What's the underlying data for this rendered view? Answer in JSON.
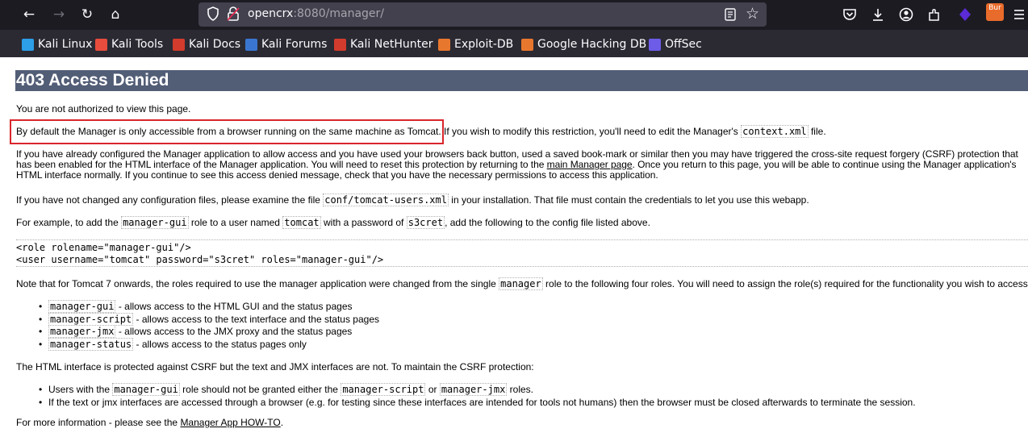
{
  "browser": {
    "nav": {
      "back": "←",
      "forward": "→",
      "reload": "↻",
      "home": "⌂"
    },
    "url": {
      "host": "opencrx",
      "rest": ":8080/manager/"
    },
    "toolbar_icons": [
      "pocket-icon",
      "download-icon",
      "account-icon",
      "extensions-icon",
      "kali-extension-icon",
      "burp-icon",
      "menu-icon"
    ],
    "burp_label": "Bur",
    "bookmarks": [
      {
        "label": "Kali Linux",
        "color": "#2d9ee8"
      },
      {
        "label": "Kali Tools",
        "color": "#e84c3d"
      },
      {
        "label": "Kali Docs",
        "color": "#d33b2c"
      },
      {
        "label": "Kali Forums",
        "color": "#3a76d1"
      },
      {
        "label": "Kali NetHunter",
        "color": "#d33b2c"
      },
      {
        "label": "Exploit-DB",
        "color": "#e8772e"
      },
      {
        "label": "Google Hacking DB",
        "color": "#e8772e"
      },
      {
        "label": "OffSec",
        "color": "#6c5ce7"
      }
    ]
  },
  "page": {
    "title": "403 Access Denied",
    "p1": "You are not authorized to view this page.",
    "p2": {
      "highlighted": "By default the Manager is only accessible from a browser running on the same machine as Tomcat.",
      "rest_before": " If you wish to modify this restriction, you'll need to edit the Manager's ",
      "code": "context.xml",
      "rest_after": " file."
    },
    "p3": {
      "before": "If you have already configured the Manager application to allow access and you have used your browsers back button, used a saved book-mark or similar then you may have triggered the cross-site request forgery (CSRF) protection that has been enabled for the HTML interface of the Manager application. You will need to reset this protection by returning to the ",
      "link": "main Manager page",
      "after": ". Once you return to this page, you will be able to continue using the Manager application's HTML interface normally. If you continue to see this access denied message, check that you have the necessary permissions to access this application."
    },
    "p4": {
      "before": "If you have not changed any configuration files, please examine the file ",
      "code": "conf/tomcat-users.xml",
      "after": " in your installation. That file must contain the credentials to let you use this webapp."
    },
    "p5": {
      "t1": "For example, to add the ",
      "c1": "manager-gui",
      "t2": " role to a user named ",
      "c2": "tomcat",
      "t3": " with a password of ",
      "c3": "s3cret",
      "t4": ", add the following to the config file listed above."
    },
    "example_code": "<role rolename=\"manager-gui\"/>\n<user username=\"tomcat\" password=\"s3cret\" roles=\"manager-gui\"/>",
    "p6": {
      "before": "Note that for Tomcat 7 onwards, the roles required to use the manager application were changed from the single ",
      "code": "manager",
      "after": " role to the following four roles. You will need to assign the role(s) required for the functionality you wish to access."
    },
    "roles": [
      {
        "code": "manager-gui",
        "desc": " - allows access to the HTML GUI and the status pages"
      },
      {
        "code": "manager-script",
        "desc": " - allows access to the text interface and the status pages"
      },
      {
        "code": "manager-jmx",
        "desc": " - allows access to the JMX proxy and the status pages"
      },
      {
        "code": "manager-status",
        "desc": " - allows access to the status pages only"
      }
    ],
    "p7": "The HTML interface is protected against CSRF but the text and JMX interfaces are not. To maintain the CSRF protection:",
    "csrf_items": {
      "i1": {
        "t1": "Users with the ",
        "c1": "manager-gui",
        "t2": " role should not be granted either the ",
        "c2": "manager-script",
        "t3": " or ",
        "c3": "manager-jmx",
        "t4": " roles."
      },
      "i2": "If the text or jmx interfaces are accessed through a browser (e.g. for testing since these interfaces are intended for tools not humans) then the browser must be closed afterwards to terminate the session."
    },
    "p8": {
      "before": "For more information - please see the ",
      "link": "Manager App HOW-TO",
      "after": "."
    }
  },
  "highlight_color": "#d9262b"
}
